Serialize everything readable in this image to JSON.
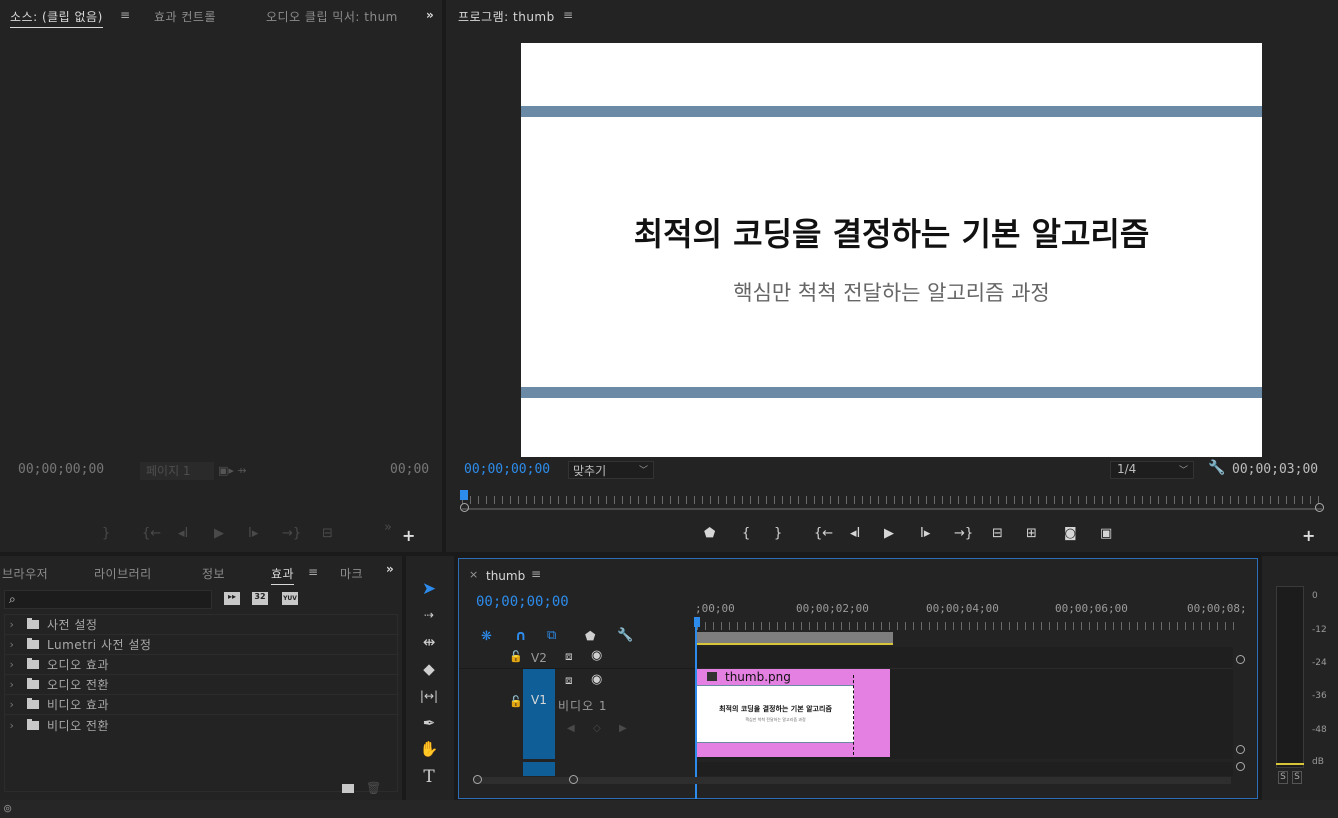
{
  "source_panel": {
    "tabs": [
      "소스: (클립 없음)",
      "효과 컨트롤",
      "오디오 클립 믹서: thum"
    ],
    "menu_glyph": "≡",
    "more_glyph": "»",
    "timecode_left": "00;00;00;00",
    "page_label": "페이지 1",
    "timecode_right": "00;00"
  },
  "program_panel": {
    "title": "프로그램: thumb",
    "menu_glyph": "≡",
    "slide_title": "최적의 코딩을 결정하는 기본 알고리즘",
    "slide_subtitle": "핵심만 척척 전달하는 알고리즘 과정",
    "timecode_current": "00;00;00;00",
    "fit_label": "맞추기",
    "resolution_label": "1/4",
    "timecode_duration": "00;00;03;00"
  },
  "project_panel": {
    "tabs": [
      "브라우저",
      "라이브러리",
      "정보",
      "효과",
      "마크"
    ],
    "menu_glyph": "≡",
    "more_glyph": "»",
    "search_placeholder": "",
    "badges": [
      "32",
      "YUV"
    ],
    "tree": [
      "사전 설정",
      "Lumetri 사전 설정",
      "오디오 효과",
      "오디오 전환",
      "비디오 효과",
      "비디오 전환"
    ]
  },
  "timeline": {
    "close_glyph": "×",
    "sequence_name": "thumb",
    "menu_glyph": "≡",
    "timecode": "00;00;00;00",
    "ruler_labels": [
      ";00;00",
      "00;00;02;00",
      "00;00;04;00",
      "00;00;06;00",
      "00;00;08;"
    ],
    "tracks": {
      "v2_label": "V2",
      "v1_label": "V1",
      "v1_name": "비디오 1"
    },
    "clip": {
      "name": "thumb.png",
      "thumb_title": "최적의 코딩을 결정하는 기본 알고리즘",
      "thumb_subtitle": "핵심만 척척 전달하는 알고리즘 과정"
    }
  },
  "audio_meter": {
    "scale": [
      "0",
      "-12",
      "-24",
      "-36",
      "-48",
      "dB"
    ],
    "solo_buttons": [
      "S",
      "S"
    ]
  },
  "colors": {
    "accent_blue": "#2d8ceb",
    "stripe": "#6b8aa6",
    "clip_pink": "#e580e3",
    "panel": "#232323"
  }
}
